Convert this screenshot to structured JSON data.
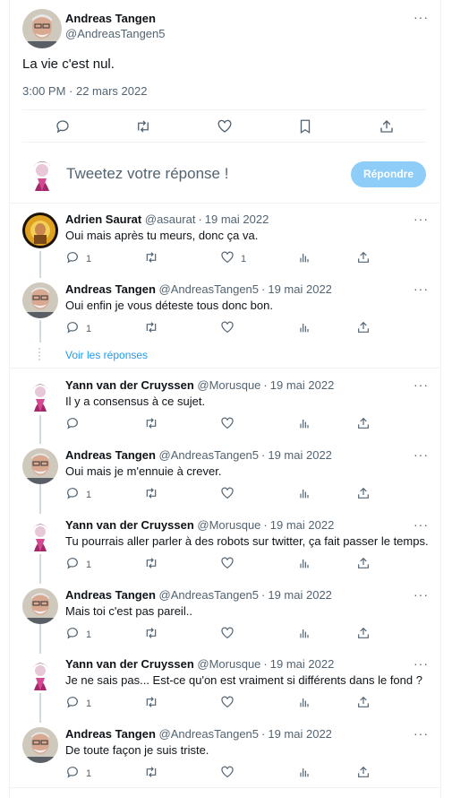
{
  "main_tweet": {
    "author": "Andreas Tangen",
    "handle": "@AndreasTangen5",
    "text": "La vie c'est nul.",
    "timestamp": "3:00 PM · 22 mars 2022"
  },
  "compose": {
    "placeholder": "Tweetez votre réponse !",
    "button_label": "Répondre"
  },
  "replies": [
    {
      "author": "Adrien Saurat",
      "handle": "@asaurat",
      "date": "19 mai 2022",
      "text": "Oui mais après tu meurs, donc ça va.",
      "reply_count": "1",
      "like_count": "1"
    },
    {
      "author": "Andreas Tangen",
      "handle": "@AndreasTangen5",
      "date": "19 mai 2022",
      "text": "Oui enfin je vous déteste tous donc bon.",
      "reply_count": "1",
      "like_count": ""
    },
    {
      "author": "Yann van der Cruyssen",
      "handle": "@Morusque",
      "date": "19 mai 2022",
      "text": "Il y a consensus à ce sujet.",
      "reply_count": "",
      "like_count": ""
    },
    {
      "author": "Andreas Tangen",
      "handle": "@AndreasTangen5",
      "date": "19 mai 2022",
      "text": "Oui mais je m'ennuie à crever.",
      "reply_count": "1",
      "like_count": ""
    },
    {
      "author": "Yann van der Cruyssen",
      "handle": "@Morusque",
      "date": "19 mai 2022",
      "text": "Tu pourrais aller parler à des robots sur twitter, ça fait passer le temps.",
      "reply_count": "1",
      "like_count": ""
    },
    {
      "author": "Andreas Tangen",
      "handle": "@AndreasTangen5",
      "date": "19 mai 2022",
      "text": "Mais toi c'est pas pareil..",
      "reply_count": "1",
      "like_count": ""
    },
    {
      "author": "Yann van der Cruyssen",
      "handle": "@Morusque",
      "date": "19 mai 2022",
      "text": "Je ne sais pas... Est-ce qu'on est vraiment si différents dans le fond ?",
      "reply_count": "1",
      "like_count": ""
    },
    {
      "author": "Andreas Tangen",
      "handle": "@AndreasTangen5",
      "date": "19 mai 2022",
      "text": "De toute façon je suis triste.",
      "reply_count": "1",
      "like_count": ""
    }
  ],
  "show_replies_label": "Voir les réponses",
  "dot_separator": "·",
  "icons": {
    "reply": "reply-icon",
    "retweet": "retweet-icon",
    "like": "like-icon",
    "bookmark": "bookmark-icon",
    "share": "share-icon",
    "views": "views-icon",
    "more": "more-icon"
  },
  "colors": {
    "accent": "#1d9bf0",
    "button_disabled": "#8ecdf8",
    "text": "#0f1419",
    "secondary": "#536471",
    "border": "#eff3f4",
    "thread": "#cfd9de"
  }
}
